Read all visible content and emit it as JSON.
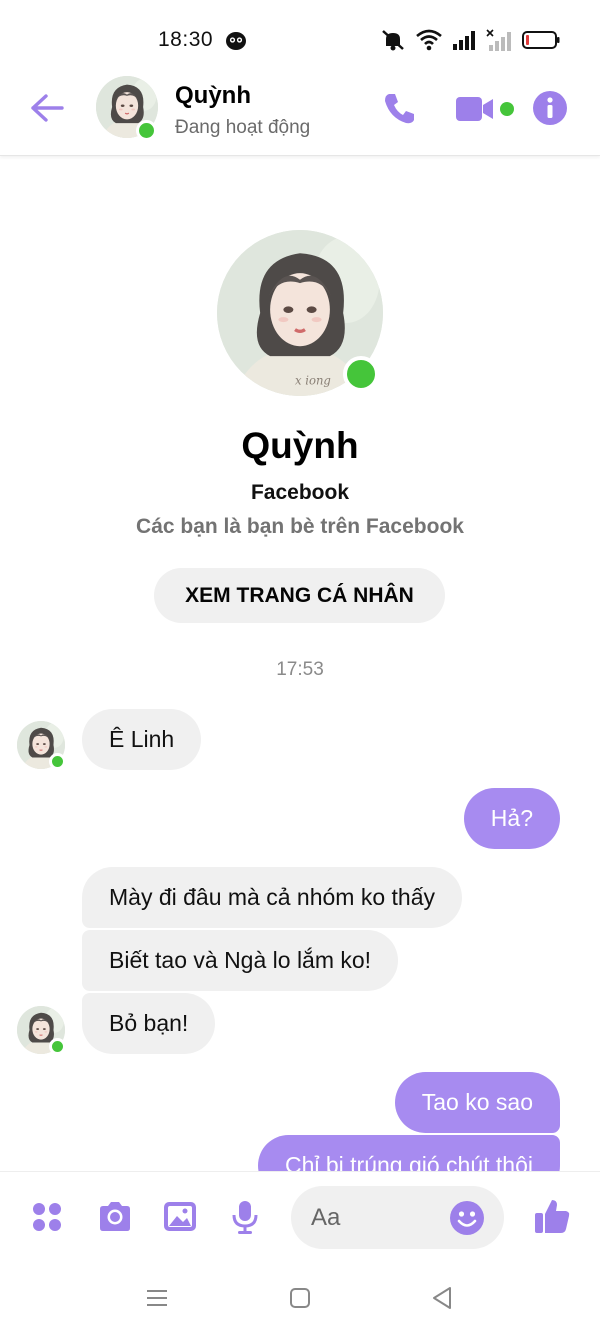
{
  "status_bar": {
    "time": "18:30"
  },
  "header": {
    "name": "Quỳnh",
    "status": "Đang hoạt động"
  },
  "profile": {
    "name": "Quỳnh",
    "platform": "Facebook",
    "relation": "Các bạn là bạn bè trên Facebook",
    "view_profile_label": "XEM TRANG CÁ NHÂN",
    "avatar_signature": "x iong"
  },
  "conversation": {
    "timestamp": "17:53",
    "messages": [
      {
        "from": "them",
        "text": "Ê Linh"
      },
      {
        "from": "me",
        "text": "Hả?"
      },
      {
        "from": "them",
        "text": "Mày đi đâu mà cả nhóm ko thấy"
      },
      {
        "from": "them",
        "text": "Biết tao và Ngà lo lắm ko!"
      },
      {
        "from": "them",
        "text": "Bỏ bạn!"
      },
      {
        "from": "me",
        "text": "Tao ko sao"
      },
      {
        "from": "me",
        "text": "Chỉ bị trúng gió chút thôi"
      }
    ]
  },
  "composer": {
    "placeholder": "Aa"
  },
  "colors": {
    "accent": "#a78bf0",
    "online": "#45c53a",
    "incoming_bubble": "#f0f0f0"
  },
  "icons": [
    "back-arrow-icon",
    "phone-icon",
    "video-camera-icon",
    "info-icon",
    "menu-dots-icon",
    "camera-icon",
    "image-icon",
    "microphone-icon",
    "emoji-icon",
    "thumbs-up-icon"
  ]
}
